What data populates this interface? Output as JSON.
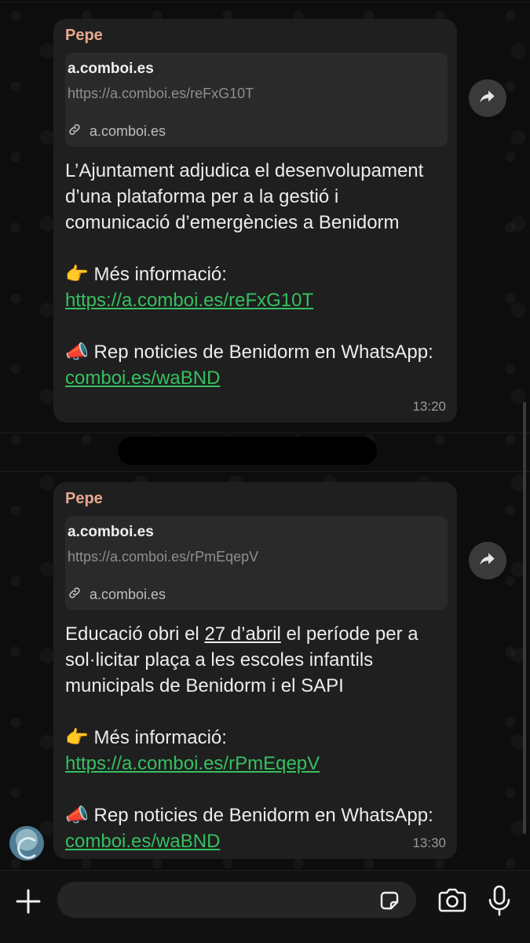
{
  "messages": [
    {
      "sender": "Pepe",
      "preview": {
        "domain": "a.comboi.es",
        "url": "https://a.comboi.es/reFxG10T",
        "host": "a.comboi.es"
      },
      "headline": "L’Ajuntament adjudica el desenvolupament d’una plataforma per a la gestió i comunicació d’emergències a Benidorm",
      "more_info_label": "👉 Més informació: ",
      "more_info_link": "https://a.comboi.es/reFxG10T",
      "news_label": "📣 Rep noticies de Benidorm en WhatsApp: ",
      "news_link": "comboi.es/waBND",
      "time": "13:20"
    },
    {
      "sender": "Pepe",
      "preview": {
        "domain": "a.comboi.es",
        "url": "https://a.comboi.es/rPmEqepV",
        "host": "a.comboi.es"
      },
      "headline_pre": "Educació obri el ",
      "headline_date": "27 d’abril",
      "headline_post": " el període per a sol·licitar plaça a les escoles infantils municipals de Benidorm i el SAPI",
      "more_info_label": "👉 Més informació: ",
      "more_info_link": "https://a.comboi.es/rPmEqepV",
      "news_label": "📣 Rep noticies de Benidorm en WhatsApp: ",
      "news_link": "comboi.es/waBND",
      "time": "13:30"
    }
  ],
  "composer": {
    "placeholder": ""
  },
  "icons": {
    "forward": "forward-icon",
    "link": "link-icon",
    "plus": "plus-icon",
    "sticker": "sticker-icon",
    "camera": "camera-icon",
    "mic": "microphone-icon"
  },
  "colors": {
    "bubble": "#1f1f1f",
    "sender": "#e7a98f",
    "link": "#35c060"
  }
}
